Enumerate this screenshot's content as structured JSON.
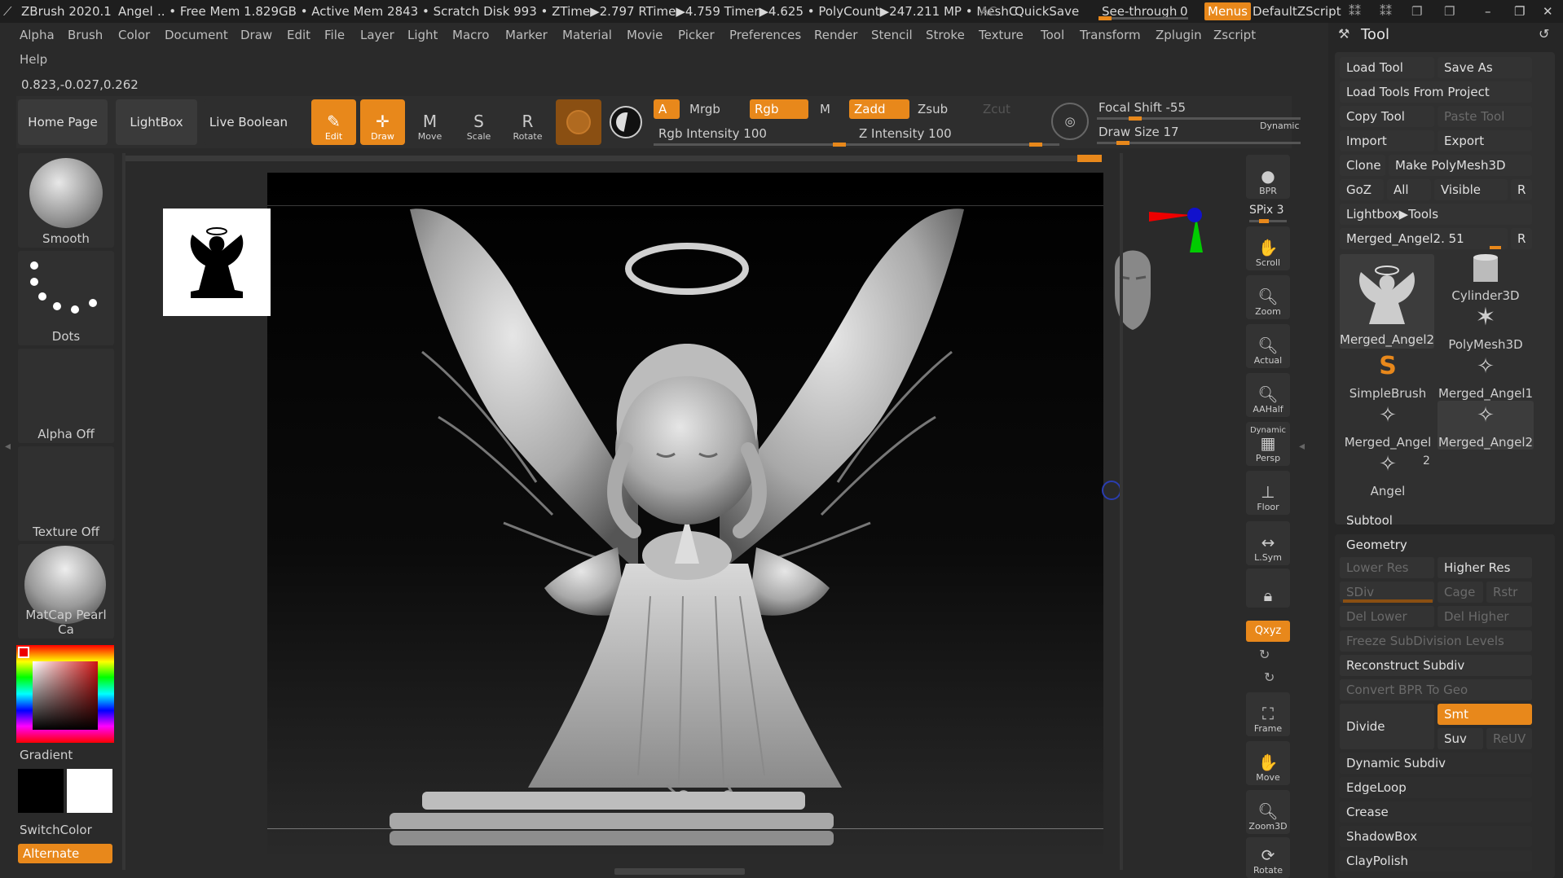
{
  "titlebar": {
    "app": "ZBrush 2020.1",
    "doc": "Angel",
    "stats": ".. • Free Mem 1.829GB • Active Mem 2843 • Scratch Disk 993 • ZTime▶2.797 RTime▶4.759 Timer▶4.625 • PolyCount▶247.211 MP • MeshC",
    "ac": "AC",
    "quicksave": "QuickSave",
    "see_through": "See-through",
    "see_through_value": "0",
    "menus": "Menus",
    "script": "DefaultZScript"
  },
  "menubar": [
    "Alpha",
    "Brush",
    "Color",
    "Document",
    "Draw",
    "Edit",
    "File",
    "Layer",
    "Light",
    "Macro",
    "Marker",
    "Material",
    "Movie",
    "Picker",
    "Preferences",
    "Render",
    "Stencil",
    "Stroke",
    "Texture",
    "Tool",
    "Transform",
    "Zplugin",
    "Zscript",
    "Help"
  ],
  "coords": "0.823,-0.027,0.262",
  "toolbar": {
    "home": "Home Page",
    "lightbox": "LightBox",
    "live_boolean": "Live Boolean",
    "edit": "Edit",
    "draw": "Draw",
    "move": "Move",
    "scale": "Scale",
    "rotate": "Rotate",
    "a": "A",
    "mrgb": "Mrgb",
    "rgb": "Rgb",
    "m": "M",
    "zadd": "Zadd",
    "zsub": "Zsub",
    "zcut": "Zcut",
    "rgb_intensity": "Rgb Intensity 100",
    "z_intensity": "Z Intensity 100",
    "focal_shift": "Focal Shift -55",
    "draw_size": "Draw Size 17",
    "dynamic": "Dynamic"
  },
  "leftpanel": {
    "brush": "Smooth",
    "stroke": "Dots",
    "alpha": "Alpha Off",
    "texture": "Texture Off",
    "material": "MatCap Pearl Ca",
    "gradient": "Gradient",
    "switch_color": "SwitchColor",
    "alternate": "Alternate"
  },
  "rightbar": {
    "bpr": "BPR",
    "spix": "SPix 3",
    "scroll": "Scroll",
    "zoom": "Zoom",
    "actual": "Actual",
    "aahalf": "AAHalf",
    "dynamic": "Dynamic",
    "persp": "Persp",
    "floor": "Floor",
    "lsym": "L.Sym",
    "xyz": "Qxyz",
    "frame": "Frame",
    "move": "Move",
    "zoom3d": "Zoom3D",
    "rotate": "Rotate"
  },
  "toolpanel": {
    "title": "Tool",
    "load_tool": "Load Tool",
    "save_as": "Save As",
    "load_from_project": "Load Tools From Project",
    "copy_tool": "Copy Tool",
    "paste_tool": "Paste Tool",
    "import": "Import",
    "export": "Export",
    "clone": "Clone",
    "make_polymesh": "Make PolyMesh3D",
    "goz": "GoZ",
    "all": "All",
    "visible": "Visible",
    "r": "R",
    "lightbox_tools": "Lightbox▶Tools",
    "current_tool": "Merged_Angel2. 51",
    "thumbs": [
      {
        "label": "Merged_Angel2"
      },
      {
        "label": "Cylinder3D"
      },
      {
        "label": "PolyMesh3D"
      },
      {
        "label": "SimpleBrush"
      },
      {
        "label": "Merged_Angel1"
      },
      {
        "label": "Merged_Angel"
      },
      {
        "label": "Merged_Angel2"
      },
      {
        "label": "Angel"
      }
    ],
    "angel_count": "2",
    "subtool": "Subtool",
    "geometry": "Geometry",
    "lower_res": "Lower Res",
    "higher_res": "Higher Res",
    "sdiv": "SDiv",
    "cage": "Cage",
    "rstr": "Rstr",
    "del_lower": "Del Lower",
    "del_higher": "Del Higher",
    "freeze": "Freeze SubDivision Levels",
    "reconstruct": "Reconstruct Subdiv",
    "convert_bpr": "Convert BPR To Geo",
    "divide": "Divide",
    "smt": "Smt",
    "suv": "Suv",
    "reuv": "ReUV",
    "dynamic_subdiv": "Dynamic Subdiv",
    "edgeloop": "EdgeLoop",
    "crease": "Crease",
    "shadowbox": "ShadowBox",
    "claypolish": "ClayPolish"
  },
  "colors": {
    "accent": "#e8881b",
    "bg": "#2a2a2a",
    "panel": "#303030"
  }
}
